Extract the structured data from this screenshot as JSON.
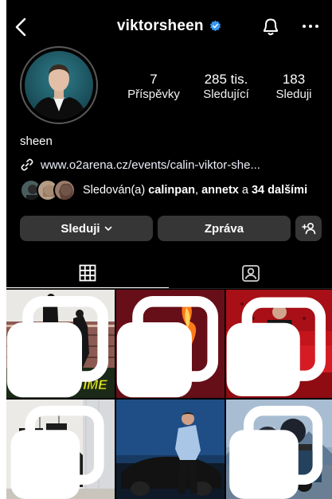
{
  "header": {
    "username": "viktorsheen",
    "back_icon": "chevron-left-icon",
    "verified_icon": "verified-badge-icon",
    "bell_icon": "bell-icon",
    "more_icon": "more-horizontal-icon"
  },
  "profile": {
    "display_name": "sheen",
    "link": "www.o2arena.cz/events/calin-viktor-she...",
    "stats": [
      {
        "value": "7",
        "label": "Příspěvky"
      },
      {
        "value": "285 tis.",
        "label": "Sledující"
      },
      {
        "value": "183",
        "label": "Sleduji"
      }
    ],
    "followed_by": {
      "prefix": "Sledován(a) ",
      "user1": "calinpan",
      "sep": ", ",
      "user2": "annetx",
      "middle": " a ",
      "others": "34 dalšími"
    }
  },
  "actions": {
    "following_label": "Sleduji",
    "message_label": "Zpráva",
    "add_user_icon": "add-person-icon"
  },
  "tabs": [
    {
      "name": "posts-grid",
      "icon": "grid-icon",
      "active": true
    },
    {
      "name": "tagged",
      "icon": "tagged-person-icon",
      "active": false
    }
  ],
  "posts": [
    {
      "title": "DOUBLE TIME",
      "multi": true
    },
    {
      "multi": true
    },
    {
      "multi": true
    },
    {
      "multi": true
    },
    {
      "multi": false
    },
    {
      "multi": true
    }
  ],
  "colors": {
    "background": "#000000",
    "button": "#363636",
    "verified": "#3797f0"
  }
}
